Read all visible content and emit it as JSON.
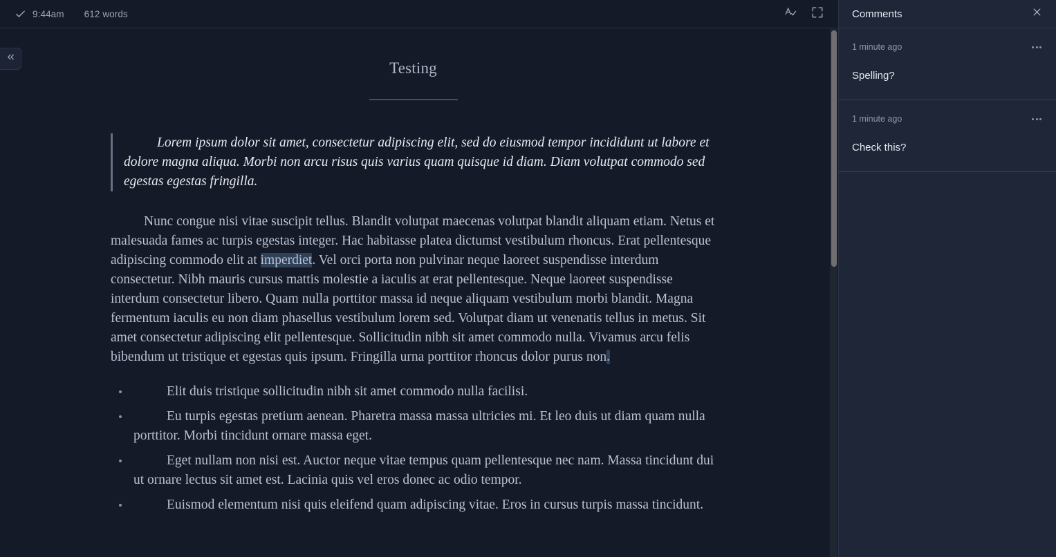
{
  "editor": {
    "header": {
      "save_status_icon": "check-icon",
      "time": "9:44am",
      "word_count": "612 words",
      "spellcheck_icon": "spellcheck-icon",
      "fullscreen_icon": "fullscreen-icon"
    },
    "collapse_sidebar_icon": "chevrons-left-icon",
    "document": {
      "title": "Testing",
      "blockquote": {
        "text_before": "Lorem ipsum dolor sit amet, consectetur adipiscing elit, sed do eiusmod tempor incididunt ut labore et dolore magna aliqua. Morbi non arcu risus quis varius quam quisque id diam. Diam volutpat commodo sed egestas egestas fringilla."
      },
      "paragraph": {
        "part1": "Nunc congue nisi vitae suscipit tellus. Blandit volutpat maecenas volutpat blandit aliquam etiam. Netus et malesuada fames ac turpis egestas integer. Hac habitasse platea dictumst vestibulum rhoncus. Erat pellentesque adipiscing commodo elit at ",
        "highlight1": "imperdiet",
        "part2": ". Vel orci porta non pulvinar neque laoreet suspendisse interdum consectetur. Nibh mauris cursus mattis molestie a iaculis at erat pellentesque. Neque laoreet suspendisse interdum consectetur libero. Quam nulla porttitor massa id neque aliquam vestibulum morbi blandit. Magna fermentum iaculis eu non diam phasellus vestibulum lorem sed. Volutpat diam ut venenatis tellus in metus. Sit amet consectetur adipiscing elit pellentesque. Sollicitudin nibh sit amet commodo nulla. Vivamus arcu felis bibendum ut tristique et egestas quis ipsum. Fringilla urna porttitor rhoncus dolor purus non",
        "highlight2": "."
      },
      "bullets": [
        "Elit duis tristique sollicitudin nibh sit amet commodo nulla facilisi.",
        "Eu turpis egestas pretium aenean. Pharetra massa massa ultricies mi. Et leo duis ut diam quam nulla porttitor. Morbi tincidunt ornare massa eget.",
        "Eget nullam non nisi est. Auctor neque vitae tempus quam pellentesque nec nam. Massa tincidunt dui ut ornare lectus sit amet est. Lacinia quis vel eros donec ac odio tempor.",
        "Euismod elementum nisi quis eleifend quam adipiscing vitae. Eros in cursus turpis massa tincidunt."
      ]
    }
  },
  "comments": {
    "title": "Comments",
    "close_icon": "close-icon",
    "items": [
      {
        "time": "1 minute ago",
        "text": "Spelling?",
        "menu_icon": "ellipsis-icon"
      },
      {
        "time": "1 minute ago",
        "text": "Check this?",
        "menu_icon": "ellipsis-icon"
      }
    ]
  },
  "colors": {
    "editor_bg": "#151a28",
    "panel_bg": "#1f2637",
    "highlight": "#2e4159",
    "body_text": "#b9c1d2",
    "scrollbar_thumb": "#6f6f6f"
  }
}
